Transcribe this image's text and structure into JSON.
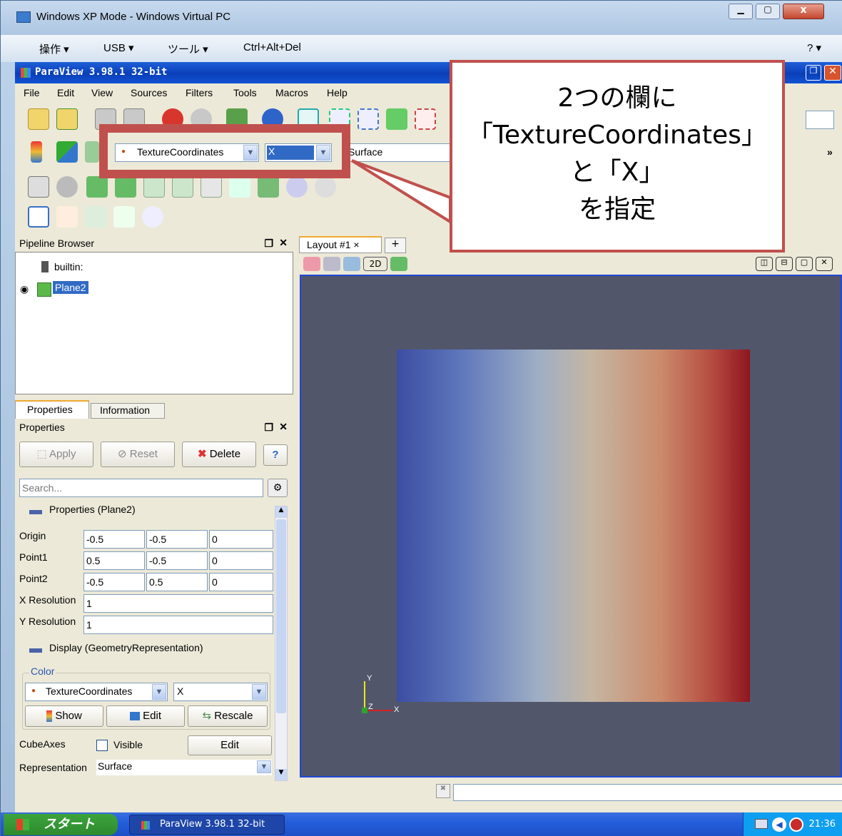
{
  "vpc": {
    "title": "Windows XP Mode - Windows Virtual PC",
    "menu": [
      "操作 ▾",
      "USB ▾",
      "ツール ▾",
      "Ctrl+Alt+Del"
    ],
    "help": "? ▾"
  },
  "paraview": {
    "title": "ParaView 3.98.1 32-bit",
    "menu": [
      "File",
      "Edit",
      "View",
      "Sources",
      "Filters",
      "Tools",
      "Macros",
      "Help"
    ],
    "color_array": "TextureCoordinates",
    "component": "X",
    "representation": "Surface",
    "more": "»"
  },
  "pipeline": {
    "header": "Pipeline Browser",
    "items": [
      "builtin:",
      "Plane2"
    ]
  },
  "tabs": {
    "properties": "Properties",
    "information": "Information"
  },
  "properties": {
    "header": "Properties",
    "apply": "Apply",
    "reset": "Reset",
    "delete": "Delete",
    "search_placeholder": "Search...",
    "section_title": "Properties (Plane2)",
    "rows": [
      {
        "label": "Origin",
        "v": [
          "-0.5",
          "-0.5",
          "0"
        ]
      },
      {
        "label": "Point1",
        "v": [
          "0.5",
          "-0.5",
          "0"
        ]
      },
      {
        "label": "Point2",
        "v": [
          "-0.5",
          "0.5",
          "0"
        ]
      }
    ],
    "x_res_label": "X Resolution",
    "x_res": "1",
    "y_res_label": "Y Resolution",
    "y_res": "1",
    "display_title": "Display (GeometryRepresentation)",
    "color_group": "Color",
    "color_array": "TextureCoordinates",
    "component": "X",
    "show": "Show",
    "edit": "Edit",
    "rescale": "Rescale",
    "cube_axes": "CubeAxes",
    "visible": "Visible",
    "cube_edit": "Edit",
    "representation_label": "Representation",
    "representation": "Surface"
  },
  "layout": {
    "tab": "Layout #1 ×",
    "add": "+",
    "mode": "2D"
  },
  "axes": {
    "x": "X",
    "y": "Y",
    "z": "Z"
  },
  "callout": [
    "2つの欄に",
    "「TextureCoordinates」",
    "と「X」",
    "を指定"
  ],
  "taskbar": {
    "start": "スタート",
    "task": "ParaView 3.98.1 32-bit",
    "time": "21:36"
  }
}
